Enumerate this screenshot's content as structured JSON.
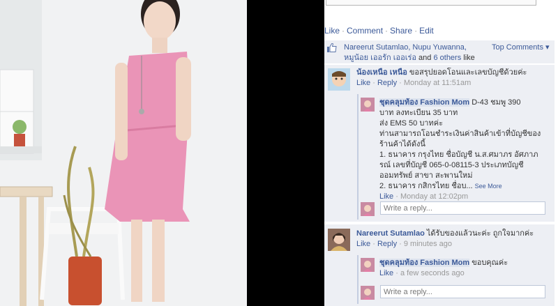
{
  "colors": {
    "link": "#3b5998",
    "comment_bg": "#edeff4",
    "dress_pink": "#e98fb4"
  },
  "post_actions": {
    "like": "Like",
    "comment": "Comment",
    "share": "Share",
    "edit": "Edit"
  },
  "likes": {
    "names_line1": "Nareerut Sutamlao, Nupu Yuwanna,",
    "name_thai": "หมูน้อย เออรัก เออเร่อ",
    "and_word": "and",
    "others": "6 others",
    "suffix": "like this.",
    "top_comments": "Top Comments ▾"
  },
  "comments": [
    {
      "author": "น้องเหนือ เหนือ",
      "text": "ขอสรุปยอดโอนและเลขบัญชีด้วยค่ะ",
      "like": "Like",
      "reply": "Reply",
      "time": "Monday at 11:51am",
      "replies": [
        {
          "author": "ชุดคลุมท้อง Fashion Mom",
          "text_lines": [
            "D-43 ชมพู 390",
            "บาท ลงทะเบียน 35 บาท",
            "ส่ง EMS 50 บาทค่ะ",
            "ท่านสามารถโอนชำระเงินค่าสินค้าเข้าที่บัญชีของ",
            "ร้านค้าได้ดังนี้",
            "1. ธนาคาร กรุงไทย ชื่อบัญชี น.ส.ศมาภร อัศภาภ",
            "รณ์ เลขที่บัญชี 065-0-08115-3 ประเภทบัญชี",
            "ออมทรัพย์ สาขา สะพานใหม่",
            "2. ธนาคาร กสิกรไทย ชื่อบ..."
          ],
          "see_more": "See More",
          "like": "Like",
          "time": "Monday at 12:02pm"
        }
      ],
      "reply_placeholder": "Write a reply..."
    },
    {
      "author": "Nareerut Sutamlao",
      "text": "ได้รับของแล้วนะค่ะ ถูกใจมากค่ะ",
      "like": "Like",
      "reply": "Reply",
      "time": "9 minutes ago",
      "replies": [
        {
          "author": "ชุดคลุมท้อง Fashion Mom",
          "text": "ขอบคุณค่ะ",
          "like": "Like",
          "time": "a few seconds ago"
        }
      ],
      "reply_placeholder": "Write a reply..."
    }
  ]
}
